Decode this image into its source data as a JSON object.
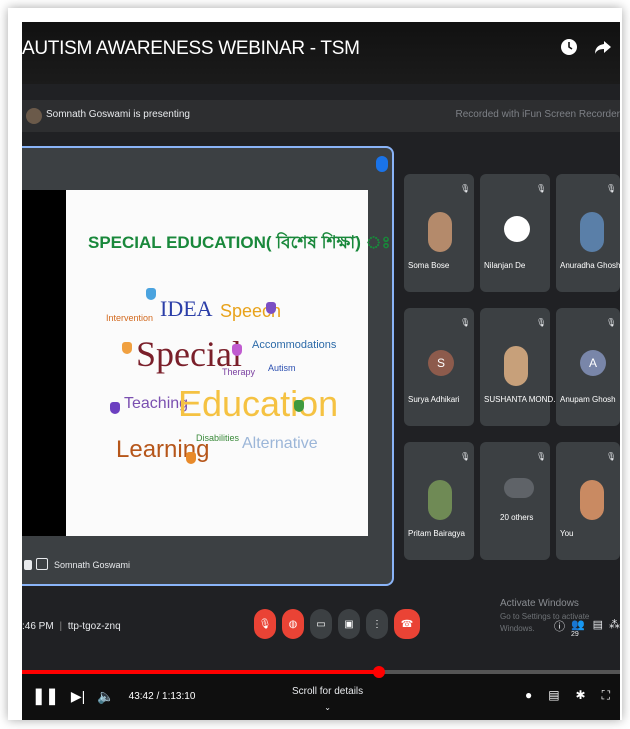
{
  "player": {
    "title": "AUTISM AWARENESS WEBINAR - TSM",
    "top_icons": [
      "clock-icon",
      "share-icon"
    ],
    "time_current": "43:42",
    "time_total": "1:13:10",
    "time_display": "43:42 / 1:13:10",
    "scroll_hint": "Scroll for details",
    "progress_fraction": 0.597
  },
  "meet": {
    "presenting_text": "Somnath Goswami is presenting",
    "recorder_text": "Recorded with iFun Screen Recorder",
    "presenter_name": "Somnath Goswami",
    "meeting_time": ":46 PM",
    "meeting_code": "ttp-tgoz-znq",
    "participants": [
      {
        "name": "Soma Bose",
        "avatar": "photo",
        "color": "#b48a6b"
      },
      {
        "name": "Nilanjan De",
        "avatar": "white-circle",
        "color": "#ffffff"
      },
      {
        "name": "Anuradha Ghosh",
        "avatar": "photo",
        "color": "#5a7fa8"
      },
      {
        "name": "Surya Adhikari",
        "avatar": "S",
        "color": "#8d5b4c"
      },
      {
        "name": "SUSHANTA MOND...",
        "avatar": "photo",
        "color": "#c7a07a"
      },
      {
        "name": "Anupam Ghosh",
        "avatar": "A",
        "color": "#7986a9"
      },
      {
        "name": "Pritam Bairagya",
        "avatar": "photo",
        "color": "#6f8a55"
      },
      {
        "name": "20 others",
        "avatar": "group",
        "color": "#5f6368"
      },
      {
        "name": "You",
        "avatar": "photo",
        "color": "#c98a62"
      }
    ],
    "activate": {
      "title": "Activate Windows",
      "sub": "Go to Settings to activate Windows."
    },
    "people_count": "29"
  },
  "slide": {
    "title": "SPECIAL EDUCATION( বিশেষ শিক্ষা) ঃ",
    "words": {
      "intervention": "Intervention",
      "idea": "IDEA",
      "speech": "Speech",
      "special": "Special",
      "accommodations": "Accommodations",
      "therapy": "Therapy",
      "autism": "Autism",
      "teaching": "Teaching",
      "education": "Education",
      "learning": "Learning",
      "disabilities": "Disabilities",
      "alternative": "Alternative"
    }
  }
}
